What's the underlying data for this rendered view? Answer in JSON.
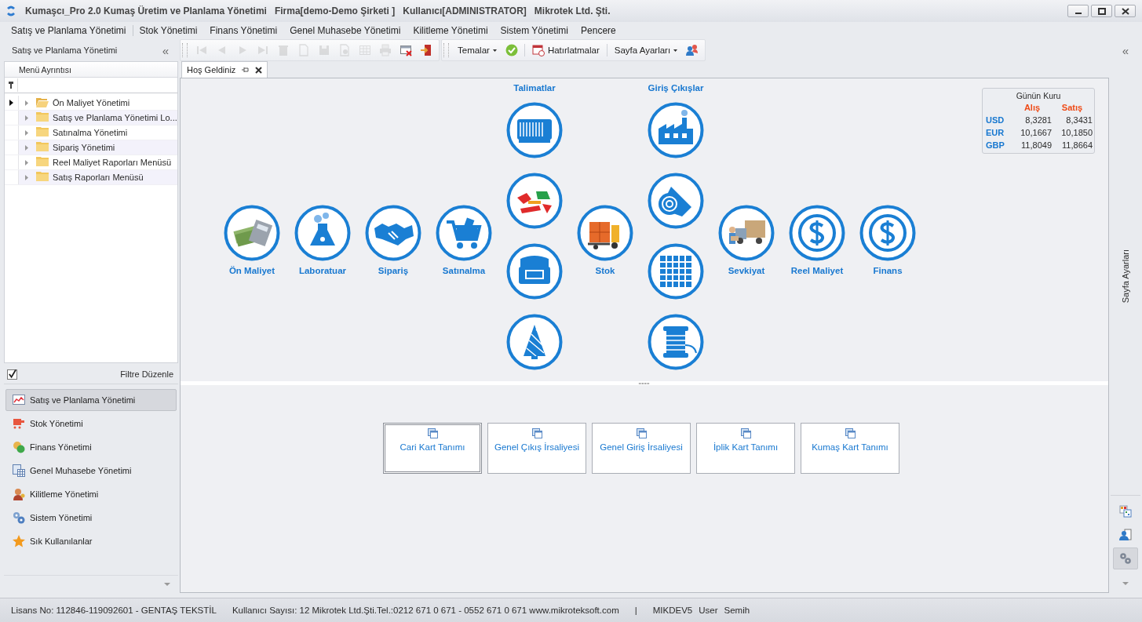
{
  "window": {
    "title_parts": [
      "Kumaşcı_Pro 2.0 Kumaş Üretim ve Planlama Yönetimi",
      "Firma[demo-Demo Şirketi ]",
      "Kullanıcı[ADMINISTRATOR]",
      "Mikrotek Ltd. Şti."
    ]
  },
  "menu": [
    "Satış ve Planlama Yönetimi",
    "Stok Yönetimi",
    "Finans Yönetimi",
    "Genel Muhasebe Yönetimi",
    "Kilitleme Yönetimi",
    "Sistem Yönetimi",
    "Pencere"
  ],
  "sidebar": {
    "title": "Satış ve Planlama Yönetimi",
    "collapse": "«",
    "column": "Menü Ayrıntısı",
    "tree": [
      {
        "label": "Ön Maliyet Yönetimi",
        "selected": true
      },
      {
        "label": "Satış ve Planlama Yönetimi Lo...",
        "selected": false
      },
      {
        "label": "Satınalma Yönetimi",
        "selected": false
      },
      {
        "label": "Sipariş Yönetimi",
        "selected": false
      },
      {
        "label": "Reel Maliyet Raporları Menüsü",
        "selected": false
      },
      {
        "label": "Satış Raporları Menüsü",
        "selected": false
      }
    ],
    "filter": {
      "label": "Filtre Düzenle",
      "checked": true
    },
    "nav": [
      {
        "label": "Satış ve Planlama Yönetimi",
        "selected": true
      },
      {
        "label": "Stok Yönetimi",
        "selected": false
      },
      {
        "label": "Finans Yönetimi",
        "selected": false
      },
      {
        "label": "Genel Muhasebe Yönetimi",
        "selected": false
      },
      {
        "label": "Kilitleme Yönetimi",
        "selected": false
      },
      {
        "label": "Sistem Yönetimi",
        "selected": false
      },
      {
        "label": "Sık Kullanılanlar",
        "selected": false
      }
    ]
  },
  "toolbar": {
    "buttons": [
      {
        "disabled": true
      },
      {
        "disabled": true
      },
      {
        "disabled": true
      },
      {
        "disabled": true
      },
      {
        "disabled": true
      },
      {
        "disabled": true
      },
      {
        "disabled": true
      },
      {
        "disabled": true
      },
      {
        "disabled": true
      },
      {
        "disabled": true
      },
      {
        "disabled": false
      },
      {
        "disabled": false
      }
    ],
    "themes": "Temalar",
    "reminders": "Hatırlatmalar",
    "page_settings": "Sayfa Ayarları"
  },
  "tabs": [
    {
      "label": "Hoş Geldiniz",
      "selected": true
    }
  ],
  "dashboard": {
    "items": [
      {
        "kind": "module",
        "label": "Ön Maliyet"
      },
      {
        "kind": "module",
        "label": "Laboratuar"
      },
      {
        "kind": "module",
        "label": "Sipariş"
      },
      {
        "kind": "module",
        "label": "Satınalma"
      },
      {
        "kind": "column",
        "title": "Talimatlar"
      },
      {
        "kind": "module",
        "label": "Stok"
      },
      {
        "kind": "column",
        "title": "Giriş Çıkışlar"
      },
      {
        "kind": "module",
        "label": "Sevkiyat"
      },
      {
        "kind": "module",
        "label": "Reel Maliyet"
      },
      {
        "kind": "module",
        "label": "Finans"
      }
    ]
  },
  "rates": {
    "title": "Günün Kuru",
    "columns": [
      "Alış",
      "Satış"
    ],
    "rows": [
      {
        "currency": "USD",
        "buy": "8,3281",
        "sell": "8,3431"
      },
      {
        "currency": "EUR",
        "buy": "10,1667",
        "sell": "10,1850"
      },
      {
        "currency": "GBP",
        "buy": "11,8049",
        "sell": "11,8664"
      }
    ]
  },
  "shortcuts": [
    {
      "label": "Cari Kart Tanımı",
      "selected": true
    },
    {
      "label": "Genel Çıkış İrsaliyesi",
      "selected": false
    },
    {
      "label": "Genel Giriş İrsaliyesi",
      "selected": false
    },
    {
      "label": "İplik Kart Tanımı",
      "selected": false
    },
    {
      "label": "Kumaş Kart Tanımı",
      "selected": false
    }
  ],
  "right_panel": {
    "collapse": "«",
    "title": "Sayfa Ayarları",
    "buttons": [
      {
        "selected": false
      },
      {
        "selected": false
      },
      {
        "selected": true
      }
    ]
  },
  "status_bar": [
    "Lisans No: 112846-119092601 - GENTAŞ TEKSTİL",
    "Kullanıcı Sayısı: 12 Mikrotek Ltd.Şti.Tel.:0212 671 0 671 - 0552 671 0 671 www.mikroteksoft.com",
    "|",
    "MIKDEV5",
    "User",
    "Semih"
  ]
}
